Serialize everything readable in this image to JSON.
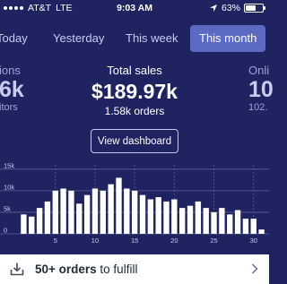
{
  "status_bar": {
    "carrier": "AT&T",
    "network": "LTE",
    "time": "9:03 AM",
    "battery": "63%",
    "battery_level": 0.63
  },
  "tabs": [
    {
      "label": "Today",
      "active": false
    },
    {
      "label": "Yesterday",
      "active": false
    },
    {
      "label": "This week",
      "active": false
    },
    {
      "label": "This month",
      "active": true
    }
  ],
  "stats": {
    "left": {
      "label": "ions",
      "value": "6k",
      "sub": "itors"
    },
    "center": {
      "label": "Total sales",
      "value": "$189.97k",
      "sub": "1.58k orders"
    },
    "right": {
      "label": "Onli",
      "value": "10",
      "sub": "102."
    }
  },
  "view_dashboard_label": "View dashboard",
  "chart_data": {
    "type": "bar",
    "x": [
      1,
      2,
      3,
      4,
      5,
      6,
      7,
      8,
      9,
      10,
      11,
      12,
      13,
      14,
      15,
      16,
      17,
      18,
      19,
      20,
      21,
      22,
      23,
      24,
      25,
      26,
      27,
      28,
      29,
      30,
      31
    ],
    "values": [
      4500,
      4000,
      6000,
      7500,
      10000,
      10500,
      10000,
      7000,
      9000,
      10500,
      10000,
      11500,
      13000,
      10500,
      10000,
      9000,
      8000,
      8500,
      7500,
      8000,
      6000,
      6500,
      7500,
      6000,
      5000,
      6000,
      4500,
      5500,
      3500,
      3500,
      1000
    ],
    "ylim": [
      0,
      16000
    ],
    "y_ticks": [
      "15k",
      "10k",
      "5k",
      "0"
    ],
    "y_tick_values": [
      15000,
      10000,
      5000,
      0
    ],
    "x_ticks": [
      "5",
      "10",
      "15",
      "20",
      "25",
      "30"
    ],
    "x_tick_values": [
      5,
      10,
      15,
      20,
      25,
      30
    ],
    "grid": true,
    "bar_color": "#ffffff",
    "grid_color": "#5b5f9a"
  },
  "bottom_bar": {
    "bold_text": "50+ orders",
    "text": " to fulfill"
  },
  "colors": {
    "background": "#1f2461",
    "accent": "#5c6ac4"
  }
}
